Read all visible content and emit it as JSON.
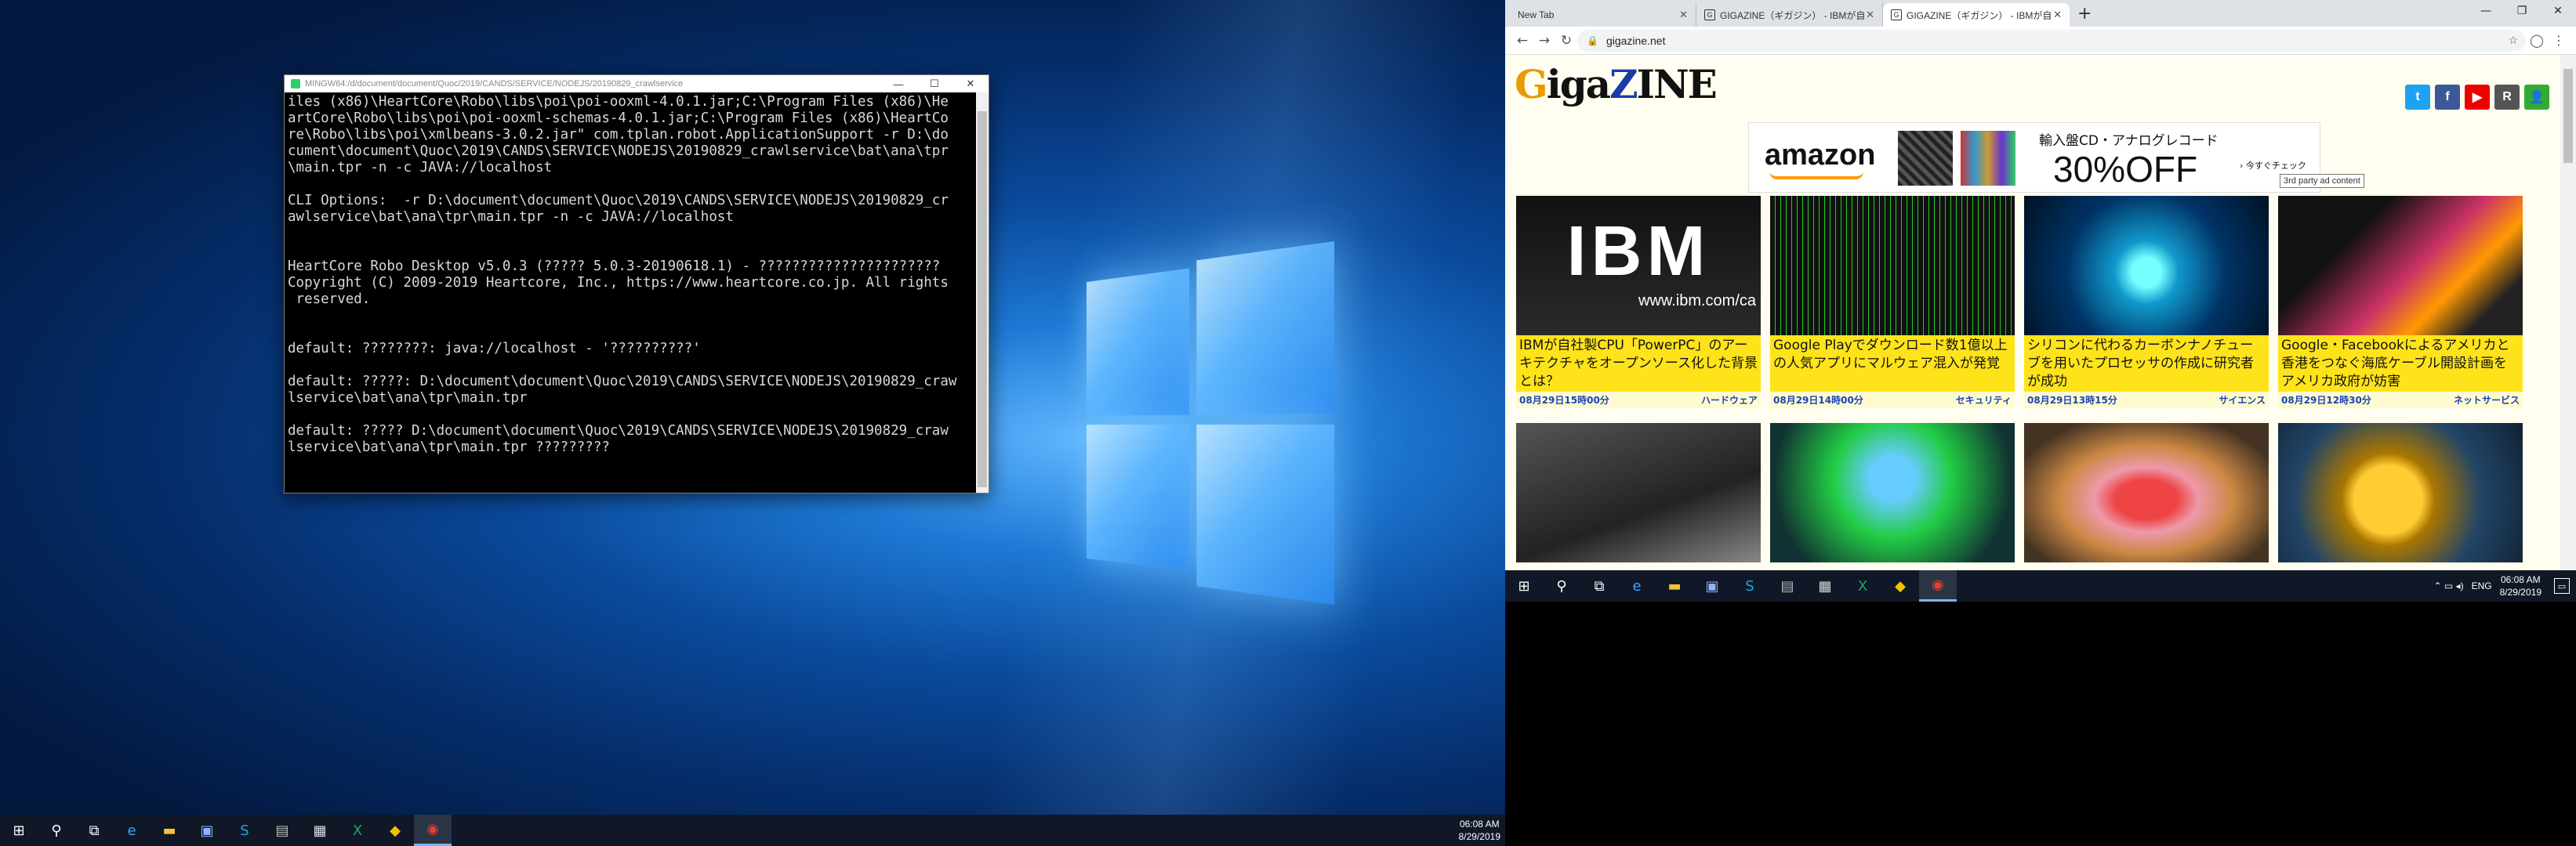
{
  "console": {
    "title": "MINGW64:/d/document/document/Quoc/2019/CANDS/SERVICE/NODEJS/20190829_crawlservice",
    "lines": [
      "iles (x86)\\HeartCore\\Robo\\libs\\poi\\poi-ooxml-4.0.1.jar;C:\\Program Files (x86)\\He",
      "artCore\\Robo\\libs\\poi\\poi-ooxml-schemas-4.0.1.jar;C:\\Program Files (x86)\\HeartCo",
      "re\\Robo\\libs\\poi\\xmlbeans-3.0.2.jar\" com.tplan.robot.ApplicationSupport -r D:\\do",
      "cument\\document\\Quoc\\2019\\CANDS\\SERVICE\\NODEJS\\20190829_crawlservice\\bat\\ana\\tpr",
      "\\main.tpr -n -c JAVA://localhost",
      "",
      "CLI Options:  -r D:\\document\\document\\Quoc\\2019\\CANDS\\SERVICE\\NODEJS\\20190829_cr",
      "awlservice\\bat\\ana\\tpr\\main.tpr -n -c JAVA://localhost",
      "",
      "",
      "HeartCore Robo Desktop v5.0.3 (????? 5.0.3-20190618.1) - ??????????????????????",
      "Copyright (C) 2009-2019 Heartcore, Inc., https://www.heartcore.co.jp. All rights",
      " reserved.",
      "",
      "",
      "default: ????????: java://localhost - '??????????'",
      "",
      "default: ?????: D:\\document\\document\\Quoc\\2019\\CANDS\\SERVICE\\NODEJS\\20190829_craw",
      "lservice\\bat\\ana\\tpr\\main.tpr",
      "",
      "default: ????? D:\\document\\document\\Quoc\\2019\\CANDS\\SERVICE\\NODEJS\\20190829_craw",
      "lservice\\bat\\ana\\tpr\\main.tpr ?????????"
    ]
  },
  "taskbar_left": {
    "time": "06:08 AM",
    "date": "8/29/2019",
    "icons": [
      "windows-start-icon",
      "search-icon",
      "task-view-icon",
      "edge-icon",
      "file-explorer-icon",
      "network-icon",
      "skype-icon",
      "terminal-icon",
      "notepad-icon",
      "excel-icon",
      "app-icon",
      "chrome-icon"
    ]
  },
  "browser": {
    "tabs": [
      {
        "label": "New Tab",
        "icon": ""
      },
      {
        "label": "GIGAZINE（ギガジン） - IBMが自",
        "icon": "G"
      },
      {
        "label": "GIGAZINE（ギガジン） - IBMが自",
        "icon": "G"
      }
    ],
    "url": "gigazine.net",
    "site": {
      "logo_g": "G",
      "logo_rest": "iga",
      "logo_z": "Z",
      "logo_end": "INE",
      "social": [
        {
          "label": "t",
          "color": "#1da1f2"
        },
        {
          "label": "f",
          "color": "#3b5998"
        },
        {
          "label": "▶",
          "color": "#e00"
        },
        {
          "label": "R",
          "color": "#555"
        },
        {
          "label": "👤",
          "color": "#3a3"
        }
      ],
      "ad": {
        "brand": "amazon",
        "headline": "輸入盤CD・アナログレコード",
        "discount": "30%OFF",
        "cta": "› 今すぐチェック"
      },
      "ad_tooltip": "3rd party ad content",
      "articles": [
        {
          "caption": "IBMが自社製CPU「PowerPC」のアーキテクチャをオープンソース化した背景とは？",
          "date": "08月29日15時00分",
          "category": "ハードウェア",
          "img": "ibm"
        },
        {
          "caption": "Google Playでダウンロード数1億以上の人気アプリにマルウェア混入が発覚",
          "date": "08月29日14時00分",
          "category": "セキュリティ",
          "img": "malware"
        },
        {
          "caption": "シリコンに代わるカーボンナノチューブを用いたプロセッサの作成に研究者が成功",
          "date": "08月29日13時15分",
          "category": "サイエンス",
          "img": "chip"
        },
        {
          "caption": "Google・Facebookによるアメリカと香港をつなぐ海底ケーブル開設計画をアメリカ政府が妨害",
          "date": "08月29日12時30分",
          "category": "ネットサービス",
          "img": "laptop"
        },
        {
          "caption": "",
          "date": "",
          "category": "",
          "img": "phone"
        },
        {
          "caption": "",
          "date": "",
          "category": "",
          "img": "siri"
        },
        {
          "caption": "",
          "date": "",
          "category": "",
          "img": "food"
        },
        {
          "caption": "",
          "date": "",
          "category": "",
          "img": "bitcoin"
        }
      ]
    }
  },
  "taskbar_right": {
    "time": "06:08 AM",
    "date": "8/29/2019",
    "lang": "ENG",
    "tray": "⌃ ▭ ◂) ",
    "notif": "▭"
  }
}
